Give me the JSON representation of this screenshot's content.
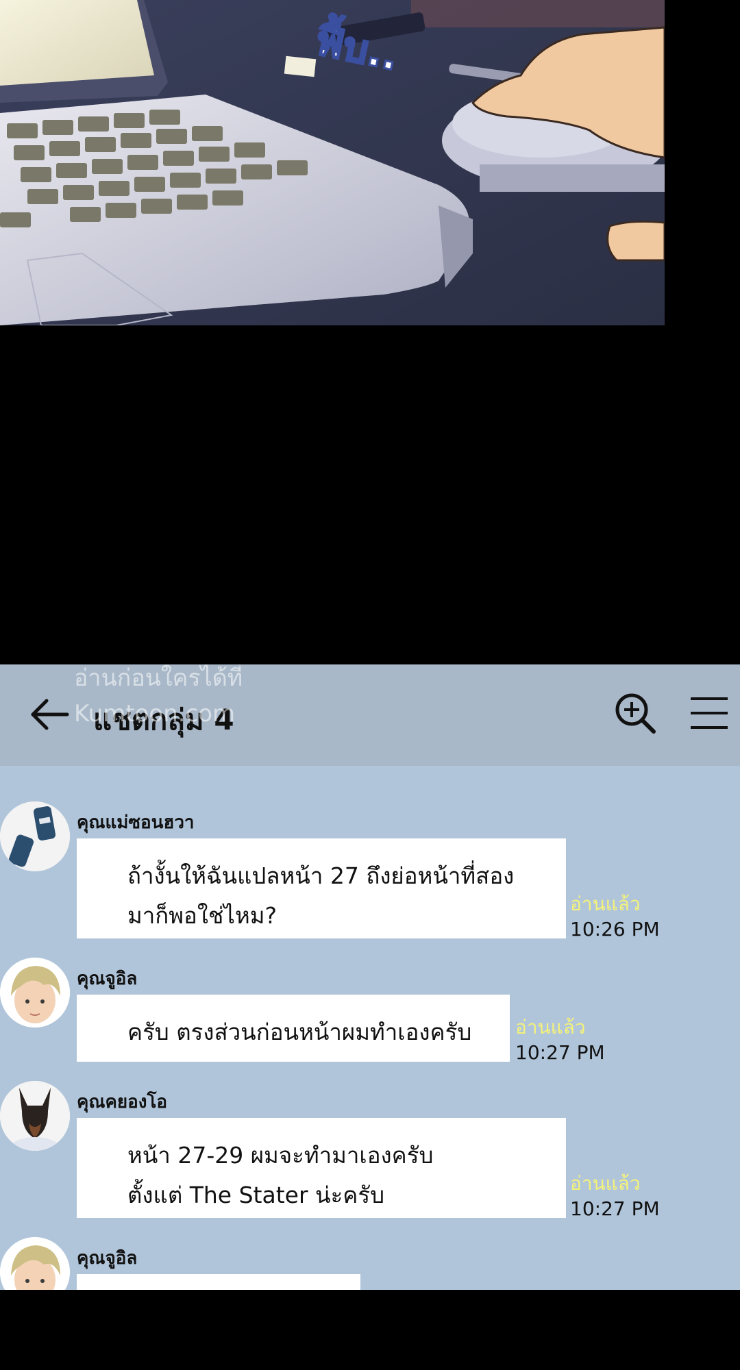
{
  "scene": {
    "sfx_text": "ฟื้บ.."
  },
  "header": {
    "watermark_line1": "อ่านก่อนใครได้ที่",
    "watermark_line2": "Kumtoon.com",
    "title": "แชตกลุ่ม 4"
  },
  "messages": [
    {
      "sender": "คุณแม่ซอนฮวา",
      "lines": [
        "ถ้างั้นให้ฉันแปลหน้า 27 ถึงย่อหน้าที่สอง",
        "มาก็พอใช่ไหม?"
      ],
      "read": "อ่านแล้ว",
      "time": "10:26 PM"
    },
    {
      "sender": "คุณจูอิล",
      "lines": [
        "ครับ ตรงส่วนก่อนหน้าผมทำเองครับ"
      ],
      "read": "อ่านแล้ว",
      "time": "10:27 PM"
    },
    {
      "sender": "คุณคยองโอ",
      "lines": [
        "หน้า 27-29 ผมจะทำมาเองครับ",
        "ตั้งแต่ The Stater น่ะครับ"
      ],
      "read": "อ่านแล้ว",
      "time": "10:27 PM"
    },
    {
      "sender": "คุณจูอิล"
    }
  ],
  "icons": {
    "back": "arrow-left-icon",
    "search": "zoom-in-icon",
    "menu": "hamburger-menu-icon"
  }
}
